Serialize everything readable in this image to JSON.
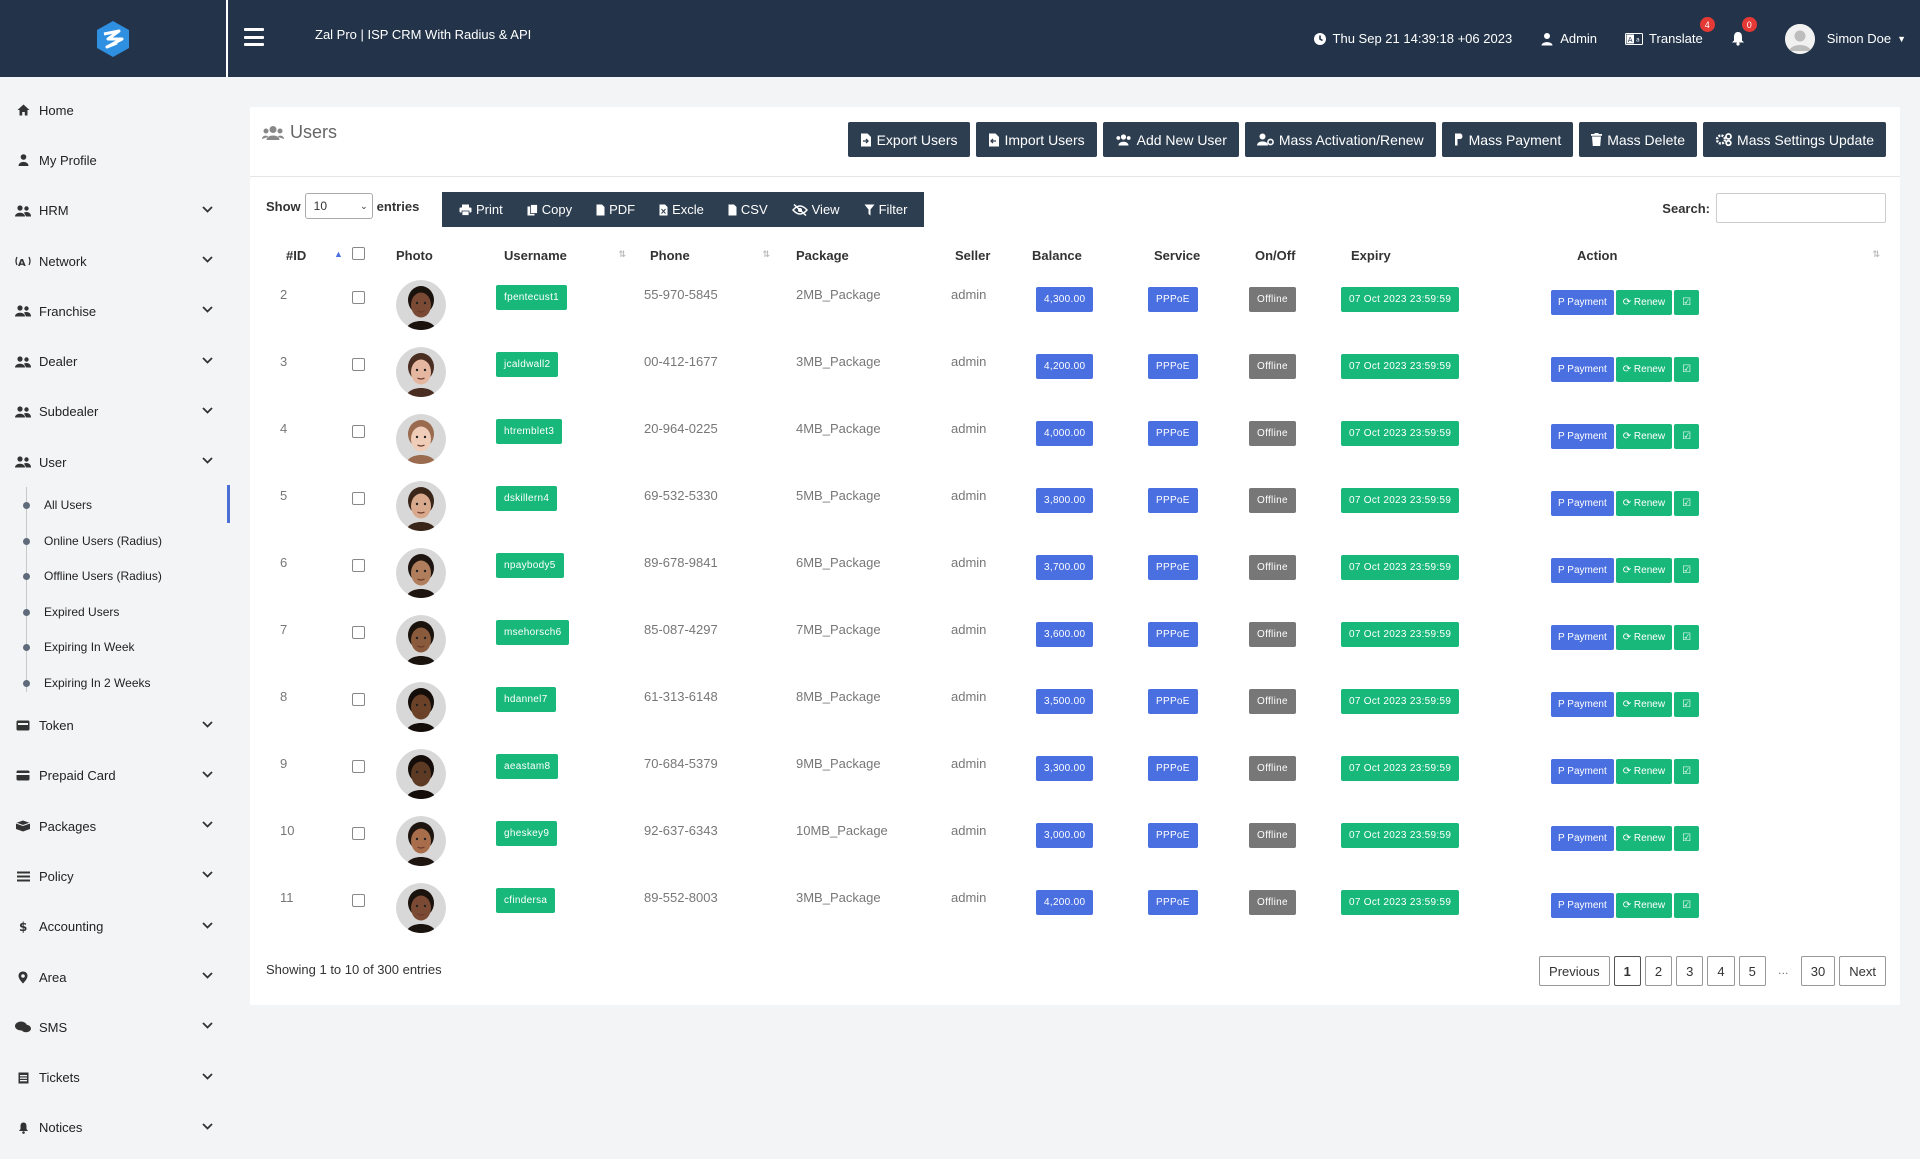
{
  "header": {
    "title": "Zal Pro | ISP CRM With Radius & API",
    "datetime": "Thu Sep 21 14:39:18 +06 2023",
    "admin_label": "Admin",
    "translate_label": "Translate",
    "translate_badge": "4",
    "notif_badge": "0",
    "user_name": "Simon Doe"
  },
  "sidebar": {
    "items": [
      {
        "label": "Home",
        "icon": "home-icon",
        "chevron": false
      },
      {
        "label": "My Profile",
        "icon": "user-icon",
        "chevron": false
      },
      {
        "label": "HRM",
        "icon": "users-icon",
        "chevron": true
      },
      {
        "label": "Network",
        "icon": "network-icon",
        "chevron": true
      },
      {
        "label": "Franchise",
        "icon": "users-icon",
        "chevron": true
      },
      {
        "label": "Dealer",
        "icon": "users-icon",
        "chevron": true
      },
      {
        "label": "Subdealer",
        "icon": "users-icon",
        "chevron": true
      },
      {
        "label": "User",
        "icon": "users-icon",
        "chevron": true
      }
    ],
    "user_subitems": [
      "All Users",
      "Online Users (Radius)",
      "Offline Users (Radius)",
      "Expired Users",
      "Expiring In Week",
      "Expiring In 2 Weeks"
    ],
    "bottom_items": [
      {
        "label": "Token",
        "icon": "token-icon",
        "chevron": true
      },
      {
        "label": "Prepaid Card",
        "icon": "card-icon",
        "chevron": true
      },
      {
        "label": "Packages",
        "icon": "packages-icon",
        "chevron": true
      },
      {
        "label": "Policy",
        "icon": "policy-icon",
        "chevron": true
      },
      {
        "label": "Accounting",
        "icon": "dollar-icon",
        "chevron": true
      },
      {
        "label": "Area",
        "icon": "map-marker-icon",
        "chevron": true
      },
      {
        "label": "SMS",
        "icon": "comments-icon",
        "chevron": true
      },
      {
        "label": "Tickets",
        "icon": "tickets-icon",
        "chevron": true
      },
      {
        "label": "Notices",
        "icon": "bell-icon",
        "chevron": true
      }
    ]
  },
  "page": {
    "title": "Users",
    "buttons": [
      "Export Users",
      "Import Users",
      "Add New User",
      "Mass Activation/Renew",
      "Mass Payment",
      "Mass Delete",
      "Mass Settings Update"
    ],
    "show_label": "Show",
    "entries_value": "10",
    "entries_label": "entries",
    "dt_buttons": [
      "Print",
      "Copy",
      "PDF",
      "Excle",
      "CSV",
      "View",
      "Filter"
    ],
    "search_label": "Search:",
    "search_value": ""
  },
  "table": {
    "columns": [
      "#ID",
      "",
      "Photo",
      "Username",
      "Phone",
      "Package",
      "Seller",
      "Balance",
      "Service",
      "On/Off",
      "Expiry",
      "Action"
    ],
    "action_labels": {
      "payment": "Payment",
      "renew": "Renew"
    },
    "rows": [
      {
        "id": "2",
        "username": "fpentecust1",
        "phone": "55-970-5845",
        "package": "2MB_Package",
        "seller": "admin",
        "balance": "4,300.00",
        "service": "PPPoE",
        "status": "Offline",
        "expiry": "07 Oct 2023 23:59:59",
        "skin": "#7a4a34",
        "hair": "#1a120d"
      },
      {
        "id": "3",
        "username": "jcaldwall2",
        "phone": "00-412-1677",
        "package": "3MB_Package",
        "seller": "admin",
        "balance": "4,200.00",
        "service": "PPPoE",
        "status": "Offline",
        "expiry": "07 Oct 2023 23:59:59",
        "skin": "#e6b7a0",
        "hair": "#4a2e22"
      },
      {
        "id": "4",
        "username": "htremblet3",
        "phone": "20-964-0225",
        "package": "4MB_Package",
        "seller": "admin",
        "balance": "4,000.00",
        "service": "PPPoE",
        "status": "Offline",
        "expiry": "07 Oct 2023 23:59:59",
        "skin": "#efcdb8",
        "hair": "#9a6b4e"
      },
      {
        "id": "5",
        "username": "dskillern4",
        "phone": "69-532-5330",
        "package": "5MB_Package",
        "seller": "admin",
        "balance": "3,800.00",
        "service": "PPPoE",
        "status": "Offline",
        "expiry": "07 Oct 2023 23:59:59",
        "skin": "#d9a98e",
        "hair": "#3a2519"
      },
      {
        "id": "6",
        "username": "npaybody5",
        "phone": "89-678-9841",
        "package": "6MB_Package",
        "seller": "admin",
        "balance": "3,700.00",
        "service": "PPPoE",
        "status": "Offline",
        "expiry": "07 Oct 2023 23:59:59",
        "skin": "#b07e5c",
        "hair": "#1e1510"
      },
      {
        "id": "7",
        "username": "msehorsch6",
        "phone": "85-087-4297",
        "package": "7MB_Package",
        "seller": "admin",
        "balance": "3,600.00",
        "service": "PPPoE",
        "status": "Offline",
        "expiry": "07 Oct 2023 23:59:59",
        "skin": "#8a5a3c",
        "hair": "#1a120d"
      },
      {
        "id": "8",
        "username": "hdannel7",
        "phone": "61-313-6148",
        "package": "8MB_Package",
        "seller": "admin",
        "balance": "3,500.00",
        "service": "PPPoE",
        "status": "Offline",
        "expiry": "07 Oct 2023 23:59:59",
        "skin": "#6b4228",
        "hair": "#140d09"
      },
      {
        "id": "9",
        "username": "aeastam8",
        "phone": "70-684-5379",
        "package": "9MB_Package",
        "seller": "admin",
        "balance": "3,300.00",
        "service": "PPPoE",
        "status": "Offline",
        "expiry": "07 Oct 2023 23:59:59",
        "skin": "#5c3a24",
        "hair": "#140d09"
      },
      {
        "id": "10",
        "username": "gheskey9",
        "phone": "92-637-6343",
        "package": "10MB_Package",
        "seller": "admin",
        "balance": "3,000.00",
        "service": "PPPoE",
        "status": "Offline",
        "expiry": "07 Oct 2023 23:59:59",
        "skin": "#a86e4c",
        "hair": "#1e1510"
      },
      {
        "id": "11",
        "username": "cfindersa",
        "phone": "89-552-8003",
        "package": "3MB_Package",
        "seller": "admin",
        "balance": "4,200.00",
        "service": "PPPoE",
        "status": "Offline",
        "expiry": "07 Oct 2023 23:59:59",
        "skin": "#7a4a34",
        "hair": "#1a120d"
      }
    ]
  },
  "footer": {
    "info": "Showing 1 to 10 of 300 entries",
    "pages": [
      "Previous",
      "1",
      "2",
      "3",
      "4",
      "5",
      "…",
      "30",
      "Next"
    ]
  }
}
